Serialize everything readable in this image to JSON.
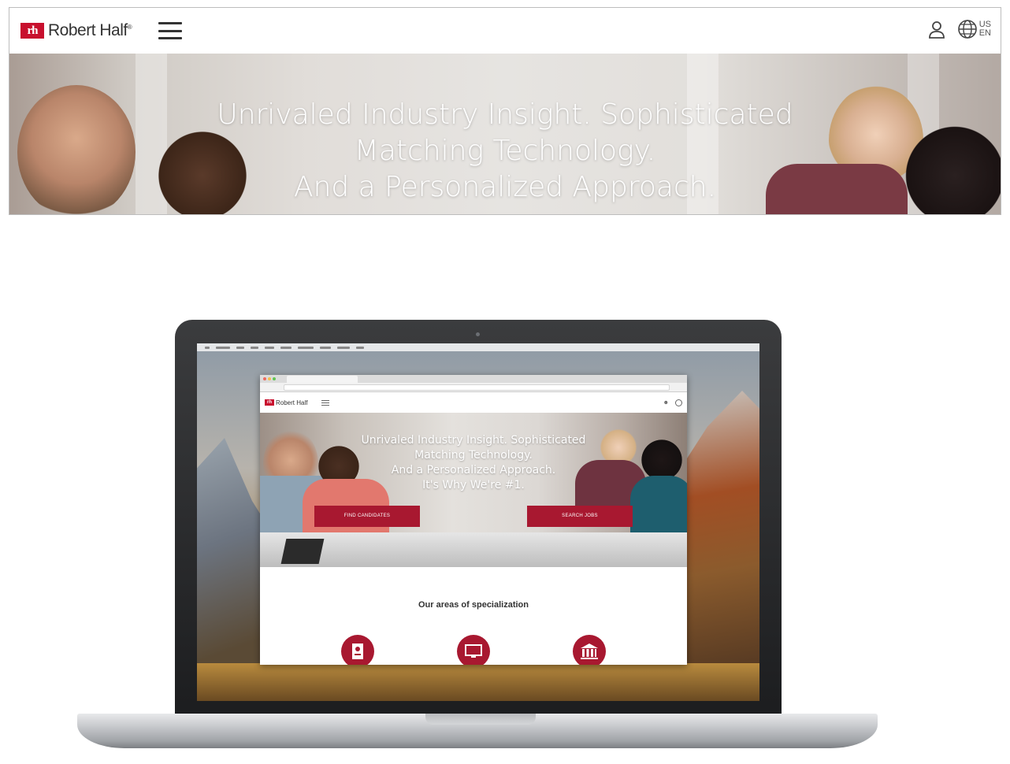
{
  "top_site": {
    "logo_mark": "rh",
    "logo_text": "Robert Half",
    "locale_country": "US",
    "locale_language": "EN",
    "hero_lines": [
      "Unrivaled Industry Insight. Sophisticated",
      "Matching Technology.",
      "And a Personalized Approach."
    ]
  },
  "laptop": {
    "browser": {
      "logo_mark": "rh",
      "logo_text": "Robert Half",
      "hero_lines": [
        "Unrivaled Industry Insight. Sophisticated",
        "Matching Technology.",
        "And a Personalized Approach.",
        "It's Why We're #1."
      ],
      "find_candidates_label": "FIND CANDIDATES",
      "search_jobs_label": "SEARCH JOBS",
      "areas_heading": "Our areas of specialization"
    }
  },
  "colors": {
    "brand_red": "#c8102e",
    "button_red": "#a81830"
  },
  "icons": [
    "menu-icon",
    "user-icon",
    "globe-icon",
    "resume-icon",
    "monitor-icon",
    "bank-icon"
  ]
}
